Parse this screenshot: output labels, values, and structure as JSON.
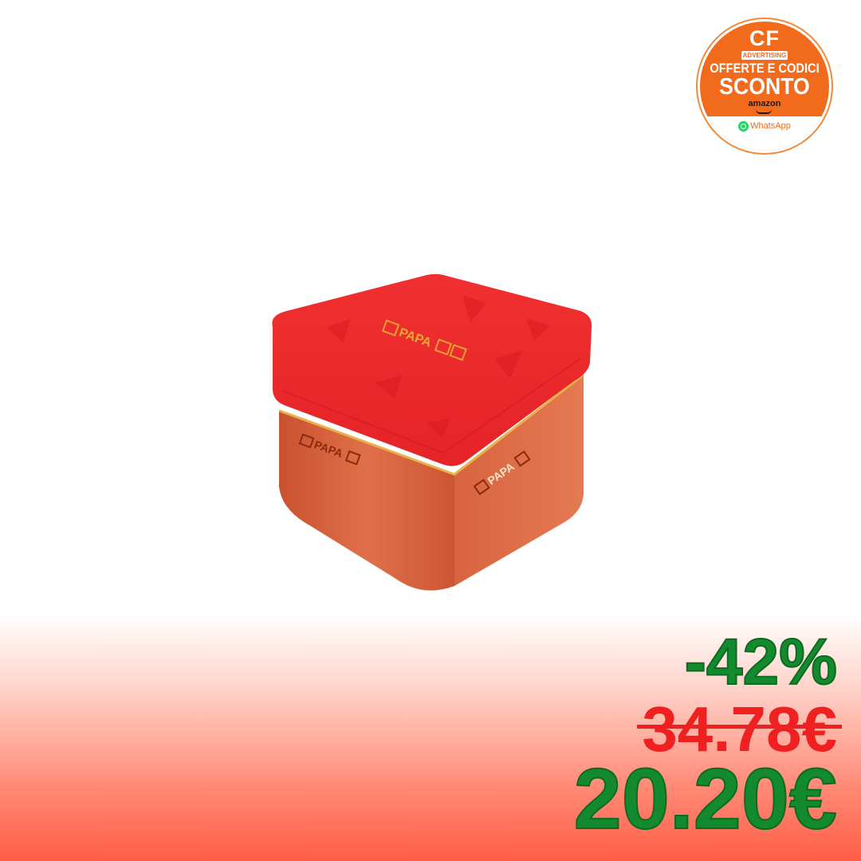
{
  "badge": {
    "brand": "CF",
    "tagline": "ADVERTISING",
    "line1": "OFFERTE E CODICI",
    "line2": "SCONTO",
    "store": "amazon",
    "channel": "WhatsApp",
    "channel_icon": "whatsapp-icon",
    "color": "#f26a1b"
  },
  "product": {
    "brand_top": "PAPA",
    "brand_front": "PAPA",
    "brand_side": "PAPA",
    "colors": {
      "lid": "#e8242b",
      "body": "#d9623e"
    }
  },
  "price": {
    "discount": "-42%",
    "old_price": "34.78€",
    "new_price": "20.20€",
    "colors": {
      "discount": "#138a2e",
      "old_price": "#ee2020",
      "new_price": "#138a2e"
    }
  }
}
